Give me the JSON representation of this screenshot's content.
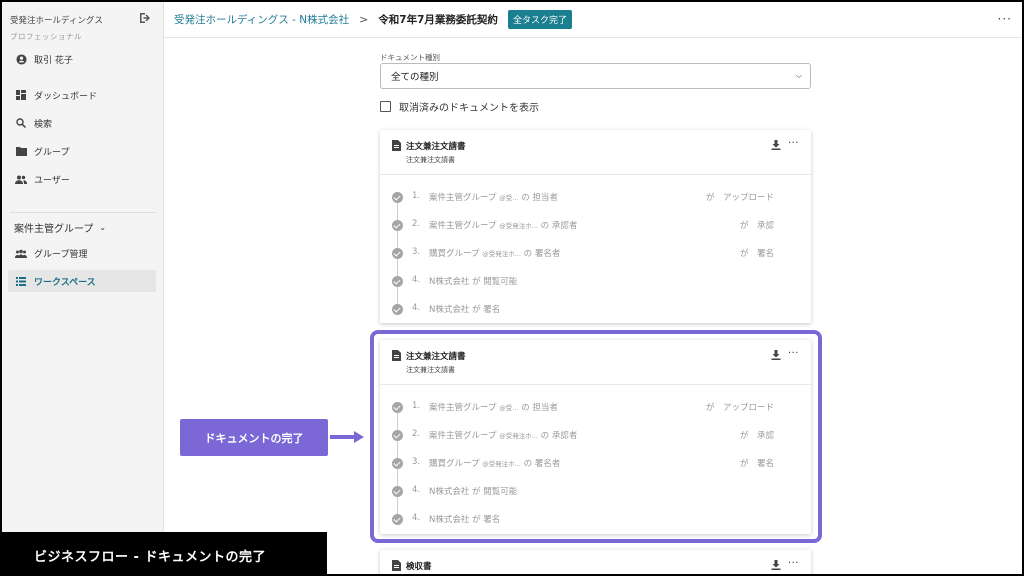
{
  "sidebar": {
    "org_name": "受発注ホールディングス",
    "plan": "プロフェッショナル",
    "user": "取引 花子",
    "nav": [
      {
        "label": "ダッシュボード"
      },
      {
        "label": "検索"
      },
      {
        "label": "グループ"
      },
      {
        "label": "ユーザー"
      }
    ],
    "group_name": "案件主管グループ",
    "group_items": [
      {
        "label": "グループ管理"
      },
      {
        "label": "ワークスペース"
      }
    ]
  },
  "header": {
    "breadcrumb_link": "受発注ホールディングス - N株式会社",
    "separator": ">",
    "current": "令和7年7月業務委託契約",
    "badge": "全タスク完了",
    "more": "···"
  },
  "filter": {
    "label": "ドキュメント種別",
    "selected": "全ての種別",
    "show_cancelled_label": "取消済みのドキュメントを表示"
  },
  "cards": [
    {
      "title": "注文兼注文請書",
      "subtitle": "注文兼注文請書",
      "steps": [
        {
          "num": "1.",
          "group": "案件主管グループ",
          "detail": "@受...",
          "particle": "の",
          "role": "担当者",
          "ga": "が",
          "action": "アップロード"
        },
        {
          "num": "2.",
          "group": "案件主管グループ",
          "detail": "@受発注ホ...",
          "particle": "の",
          "role": "承認者",
          "ga": "が",
          "action": "承認"
        },
        {
          "num": "3.",
          "group": "購買グループ",
          "detail": "@受発注ホ...",
          "particle": "の",
          "role": "署名者",
          "ga": "が",
          "action": "署名"
        },
        {
          "num": "4.",
          "group": "N株式会社",
          "detail": "",
          "particle": "が",
          "role": "閲覧可能",
          "ga": "",
          "action": ""
        },
        {
          "num": "4.",
          "group": "N株式会社",
          "detail": "",
          "particle": "が",
          "role": "署名",
          "ga": "",
          "action": ""
        }
      ]
    },
    {
      "title": "注文兼注文請書",
      "subtitle": "注文兼注文請書",
      "steps": [
        {
          "num": "1.",
          "group": "案件主管グループ",
          "detail": "@受...",
          "particle": "の",
          "role": "担当者",
          "ga": "が",
          "action": "アップロード"
        },
        {
          "num": "2.",
          "group": "案件主管グループ",
          "detail": "@受発注ホ...",
          "particle": "の",
          "role": "承認者",
          "ga": "が",
          "action": "承認"
        },
        {
          "num": "3.",
          "group": "購買グループ",
          "detail": "@受発注ホ...",
          "particle": "の",
          "role": "署名者",
          "ga": "が",
          "action": "署名"
        },
        {
          "num": "4.",
          "group": "N株式会社",
          "detail": "",
          "particle": "が",
          "role": "閲覧可能",
          "ga": "",
          "action": ""
        },
        {
          "num": "4.",
          "group": "N株式会社",
          "detail": "",
          "particle": "が",
          "role": "署名",
          "ga": "",
          "action": ""
        }
      ]
    },
    {
      "title": "検収書",
      "subtitle": ""
    }
  ],
  "callout": "ドキュメントの完了",
  "caption": "ビジネスフロー ‐ ドキュメントの完了",
  "colors": {
    "accent": "#1a7f8e",
    "highlight": "#7b68d6",
    "link": "#1f7a95"
  }
}
